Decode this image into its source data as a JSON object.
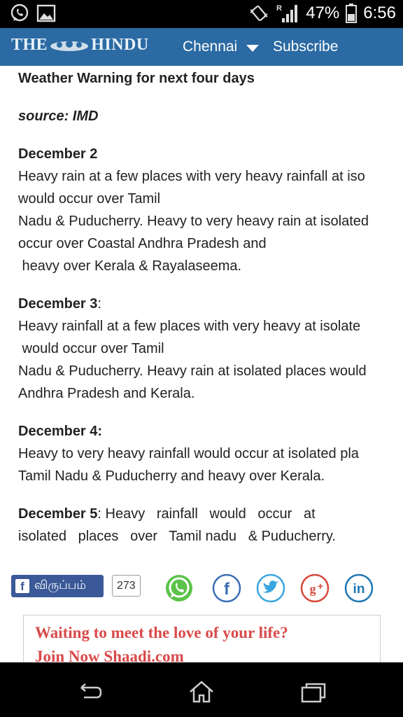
{
  "status_bar": {
    "battery": "47%",
    "time": "6:56",
    "roaming": "R",
    "icons": [
      "whatsapp-icon",
      "image-icon",
      "vibrate-icon",
      "signal-icon",
      "battery-icon"
    ]
  },
  "header": {
    "logo_left": "THE",
    "logo_right": "HINDU",
    "city": "Chennai",
    "subscribe": "Subscribe",
    "background": "#2b6aa3"
  },
  "article": {
    "title": "Weather Warning for next four days",
    "source": "source: IMD",
    "sections": [
      {
        "date": "December 2",
        "date_suffix": "",
        "lines": [
          "Heavy rain at a few places with very heavy rainfall at iso",
          "would occur over Tamil",
          "Nadu & Puducherry. Heavy to very heavy rain at isolated",
          "occur over Coastal Andhra Pradesh and",
          " heavy over Kerala & Rayalaseema."
        ]
      },
      {
        "date": "December 3",
        "date_suffix": ":",
        "lines": [
          "Heavy rainfall at a few places with very heavy at isolate",
          " would occur over Tamil",
          "Nadu & Puducherry. Heavy rain at isolated places would",
          "Andhra Pradesh and Kerala."
        ]
      },
      {
        "date": "December 4:",
        "date_suffix": "",
        "lines": [
          "Heavy to very heavy rainfall would occur at isolated pla",
          "Tamil Nadu & Puducherry and heavy over Kerala."
        ]
      },
      {
        "date": "December 5",
        "date_suffix": ": Heavy   rainfall   would   occur   at",
        "lines": [
          "isolated   places   over   Tamil nadu   & Puducherry."
        ]
      }
    ]
  },
  "social": {
    "like_label": "விருப்பம்",
    "like_count": "273",
    "share_icons": [
      "whatsapp-share-icon",
      "facebook-share-icon",
      "twitter-share-icon",
      "google-plus-share-icon",
      "linkedin-share-icon"
    ]
  },
  "ad": {
    "line1": "Waiting to meet the love of your life?",
    "line2": "Join Now Shaadi.com"
  },
  "nav": {
    "icons": [
      "back-icon",
      "home-icon",
      "recent-apps-icon"
    ]
  }
}
